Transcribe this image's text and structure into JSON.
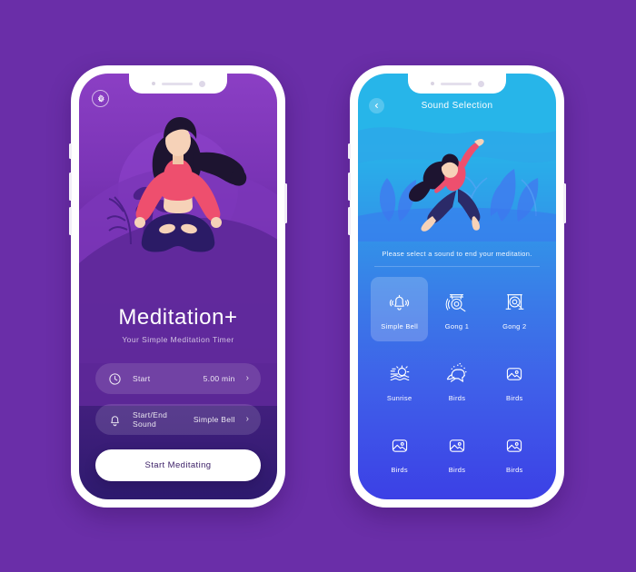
{
  "background_color": "#6a2ea8",
  "phone1": {
    "name": "meditation-home-screen",
    "gear_icon": "gear-icon",
    "title": "Meditation+",
    "subtitle": "Your Simple Meditation Timer",
    "rows": [
      {
        "icon": "clock-icon",
        "label": "Start",
        "value": "5.00 min",
        "chevron": "›"
      },
      {
        "icon": "bell-icon",
        "label": "Start/End Sound",
        "value": "Simple Bell",
        "chevron": "›"
      }
    ],
    "cta_label": "Start Meditating",
    "illustration": "meditating-woman-lotus-pose",
    "colors": {
      "screen_top": "#8b3fc4",
      "screen_bottom": "#2e1a6e",
      "shirt": "#ee4f6e",
      "pants": "#2b1b66",
      "skin": "#f6d2b8"
    }
  },
  "phone2": {
    "name": "sound-selection-screen",
    "back_icon": "chevron-left-icon",
    "title": "Sound Selection",
    "instruction": "Please select a sound to end your meditation.",
    "illustration": "yoga-woman-warrior-pose",
    "sounds": [
      {
        "label": "Simple Bell",
        "icon": "bell-icon",
        "selected": true
      },
      {
        "label": "Gong 1",
        "icon": "gong-icon",
        "selected": false
      },
      {
        "label": "Gong 2",
        "icon": "gong-square-icon",
        "selected": false
      },
      {
        "label": "Sunrise",
        "icon": "sunrise-icon",
        "selected": false
      },
      {
        "label": "Birds",
        "icon": "bird-icon",
        "selected": false
      },
      {
        "label": "Birds",
        "icon": "image-placeholder-icon",
        "selected": false
      },
      {
        "label": "Birds",
        "icon": "image-placeholder-icon",
        "selected": false
      },
      {
        "label": "Birds",
        "icon": "image-placeholder-icon",
        "selected": false
      },
      {
        "label": "Birds",
        "icon": "image-placeholder-icon",
        "selected": false
      }
    ],
    "colors": {
      "header": "#27b5e9",
      "screen_bottom": "#3c40e6",
      "shirt": "#ee4f6e",
      "pants": "#2b2a68"
    }
  }
}
